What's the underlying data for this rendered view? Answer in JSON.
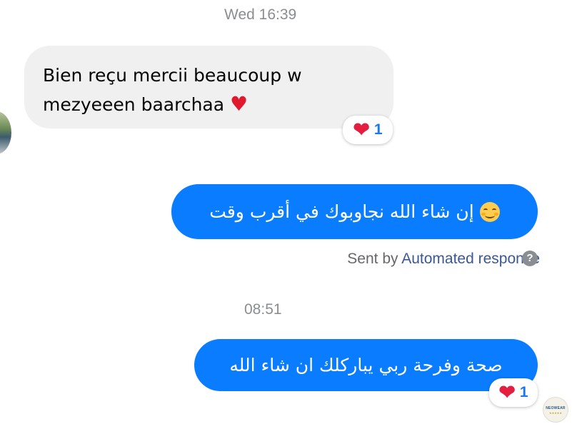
{
  "conversation": {
    "timestamp_1": "Wed 16:39",
    "timestamp_2": "08:51"
  },
  "incoming_message": {
    "text": "Bien reçu mercii beaucoup w mezyeeen baarchaa",
    "emoji": "♥",
    "reaction": {
      "icon": "heart-icon",
      "count": "1"
    }
  },
  "outgoing_message_1": {
    "text": "إن شاء الله نجاوبوك في أقرب وقت",
    "emoji": "smiling-face-icon"
  },
  "sent_by": {
    "prefix": "Sent by",
    "link": "Automated response",
    "help_icon": "?"
  },
  "outgoing_message_2": {
    "text": "صحة وفرحة ربي يباركلك ان شاء الله",
    "reaction": {
      "icon": "heart-icon",
      "count": "1"
    }
  },
  "avatar_logo": {
    "text": "NEOWEAR",
    "stars": "★★★★★"
  },
  "colors": {
    "outgoing_bubble": "#0a7cff",
    "incoming_bubble": "#f0f0f0",
    "reaction_count": "#1877f2",
    "link": "#385898",
    "heart": "#e41e3f"
  }
}
